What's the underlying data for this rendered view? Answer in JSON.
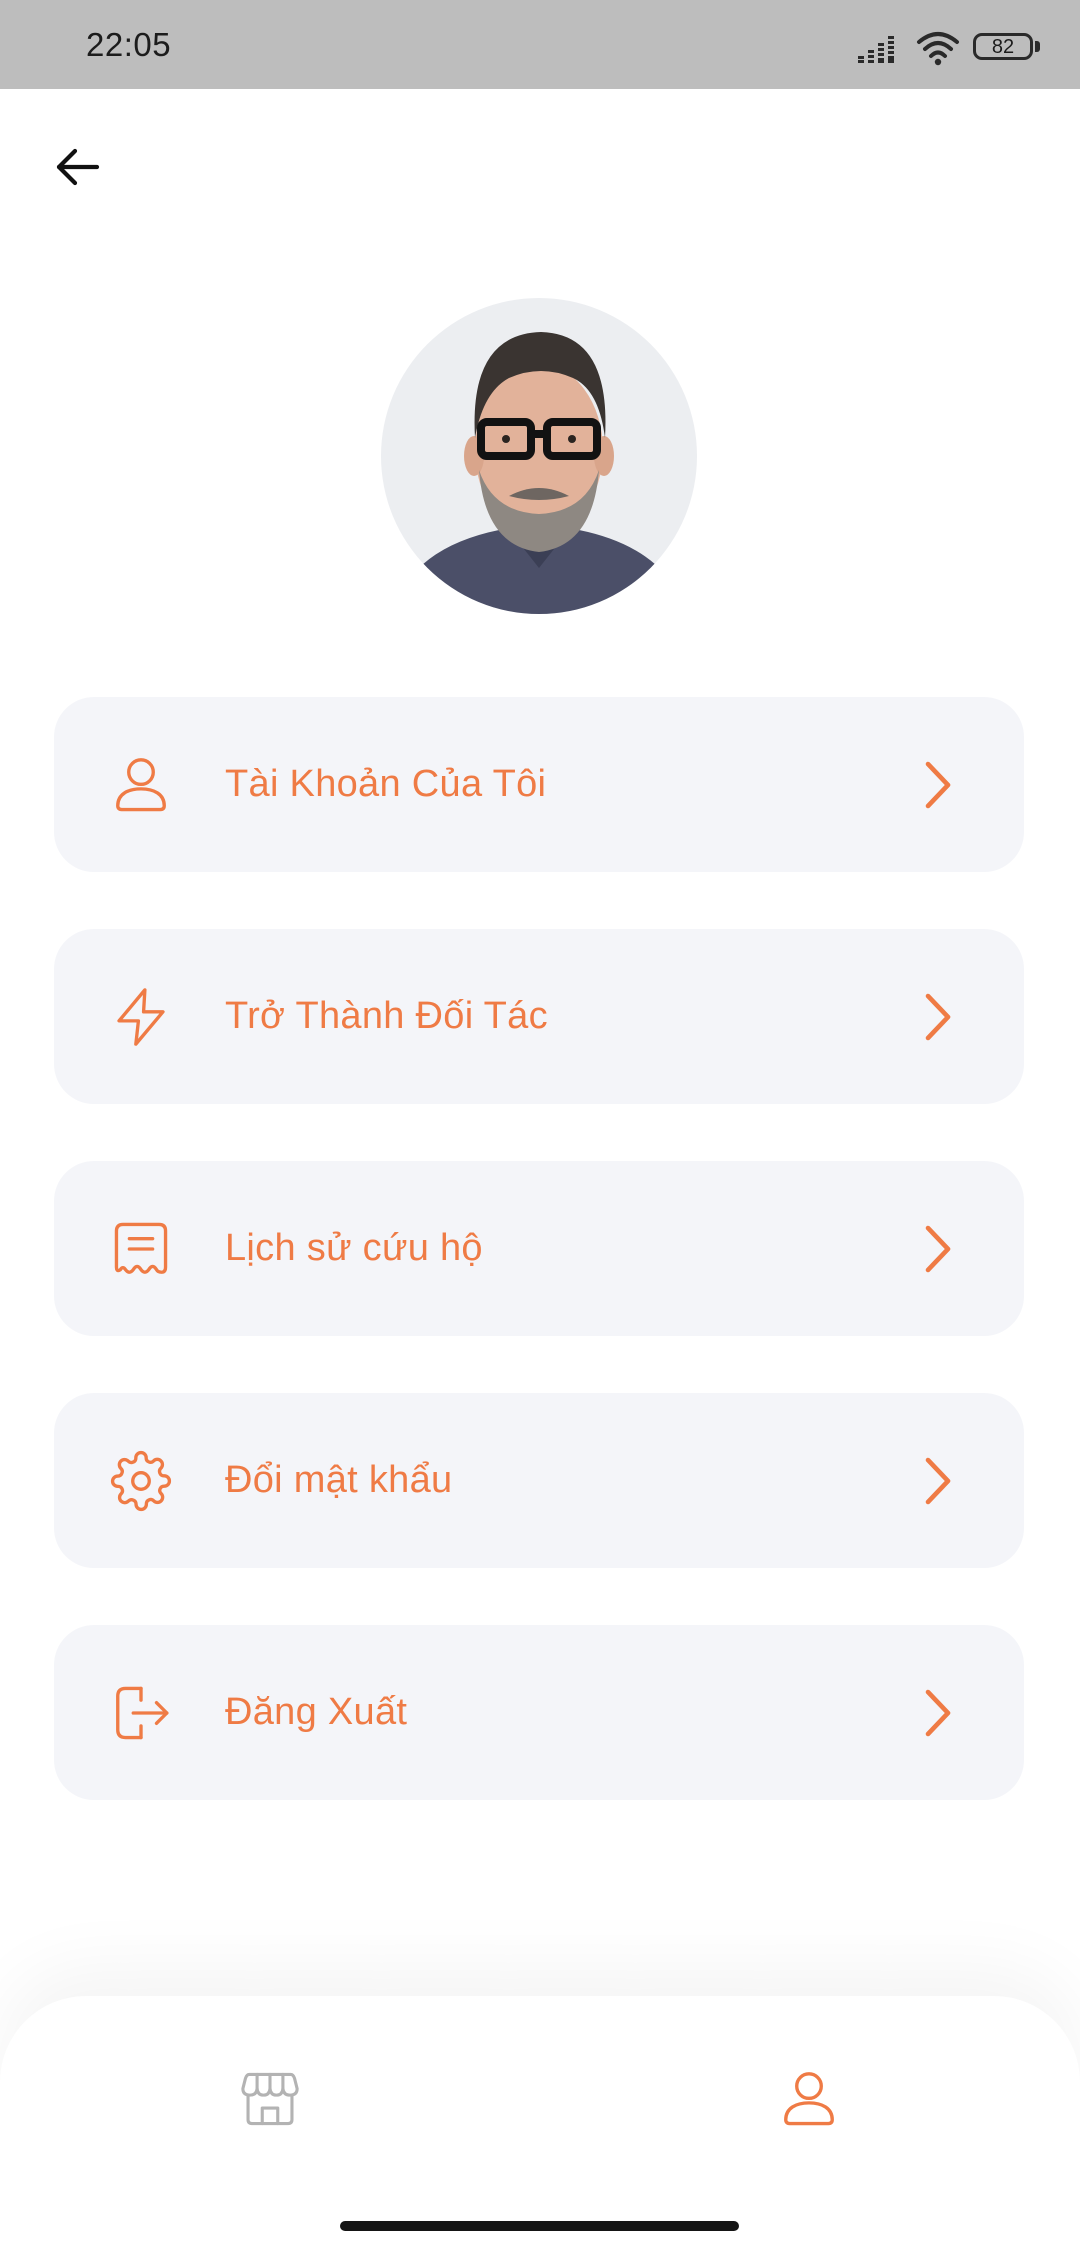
{
  "status_bar": {
    "time": "22:05",
    "battery": "82",
    "icons": [
      "signal-icon",
      "wifi-icon",
      "battery-icon"
    ]
  },
  "header": {
    "back_icon": "arrow-left-icon"
  },
  "profile": {
    "avatar": "profile-photo"
  },
  "menu": {
    "items": [
      {
        "label": "Tài Khoản Của Tôi",
        "icon": "user-icon"
      },
      {
        "label": "Trở Thành Đối Tác",
        "icon": "lightning-icon"
      },
      {
        "label": "Lịch sử cứu hộ",
        "icon": "receipt-icon"
      },
      {
        "label": "Đổi mật khẩu",
        "icon": "gear-icon"
      },
      {
        "label": "Đăng Xuất",
        "icon": "logout-icon"
      }
    ],
    "trailing_icon": "chevron-right-icon"
  },
  "bottom_nav": {
    "items": [
      {
        "icon": "store-icon",
        "active": false
      },
      {
        "icon": "user-icon",
        "active": true
      }
    ]
  },
  "colors": {
    "accent": "#ef7b45",
    "card_background": "#f4f5f9",
    "status_bar_background": "#bdbdbd",
    "nav_inactive": "#b3b3b3",
    "text_dark": "#111111"
  }
}
